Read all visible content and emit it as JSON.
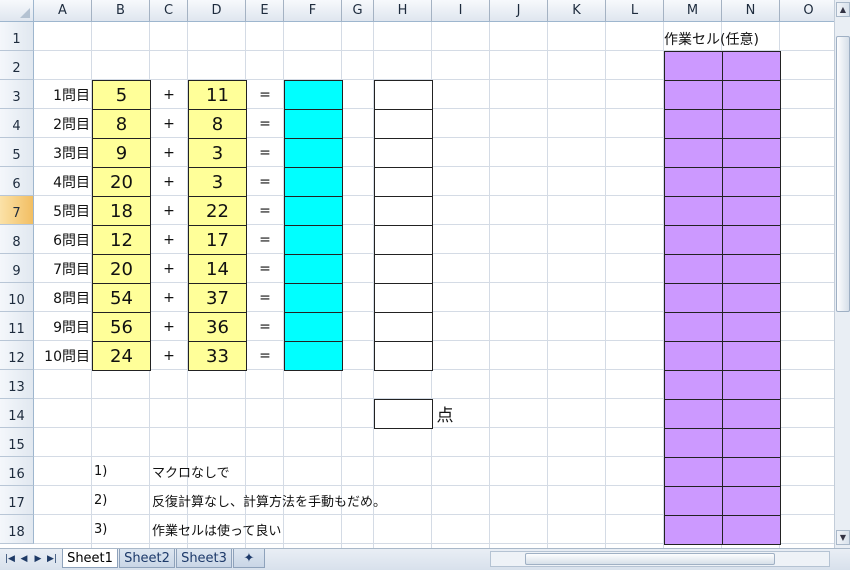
{
  "columns": [
    "A",
    "B",
    "C",
    "D",
    "E",
    "F",
    "G",
    "H",
    "I",
    "J",
    "K",
    "L",
    "M",
    "N",
    "O"
  ],
  "rows": [
    "1",
    "2",
    "3",
    "4",
    "5",
    "6",
    "7",
    "8",
    "9",
    "10",
    "11",
    "12",
    "13",
    "14",
    "15",
    "16",
    "17",
    "18"
  ],
  "selected_row": "7",
  "work_cell_header": "作業セル(任意)",
  "problems": [
    {
      "label": "1問目",
      "a": "5",
      "op": "+",
      "b": "11",
      "eq": "="
    },
    {
      "label": "2問目",
      "a": "8",
      "op": "+",
      "b": "8",
      "eq": "="
    },
    {
      "label": "3問目",
      "a": "9",
      "op": "+",
      "b": "3",
      "eq": "="
    },
    {
      "label": "4問目",
      "a": "20",
      "op": "+",
      "b": "3",
      "eq": "="
    },
    {
      "label": "5問目",
      "a": "18",
      "op": "+",
      "b": "22",
      "eq": "="
    },
    {
      "label": "6問目",
      "a": "12",
      "op": "+",
      "b": "17",
      "eq": "="
    },
    {
      "label": "7問目",
      "a": "20",
      "op": "+",
      "b": "14",
      "eq": "="
    },
    {
      "label": "8問目",
      "a": "54",
      "op": "+",
      "b": "37",
      "eq": "="
    },
    {
      "label": "9問目",
      "a": "56",
      "op": "+",
      "b": "36",
      "eq": "="
    },
    {
      "label": "10問目",
      "a": "24",
      "op": "+",
      "b": "33",
      "eq": "="
    }
  ],
  "score_label": "点",
  "notes": [
    {
      "num": "1)",
      "text": "マクロなしで"
    },
    {
      "num": "2)",
      "text": "反復計算なし、計算方法を手動もだめ。"
    },
    {
      "num": "3)",
      "text": "作業セルは使って良い"
    }
  ],
  "sheet_tabs": [
    "Sheet1",
    "Sheet2",
    "Sheet3"
  ],
  "active_tab": "Sheet1",
  "colors": {
    "input": "#ffff99",
    "answer": "#00ffff",
    "work": "#cc99ff"
  }
}
